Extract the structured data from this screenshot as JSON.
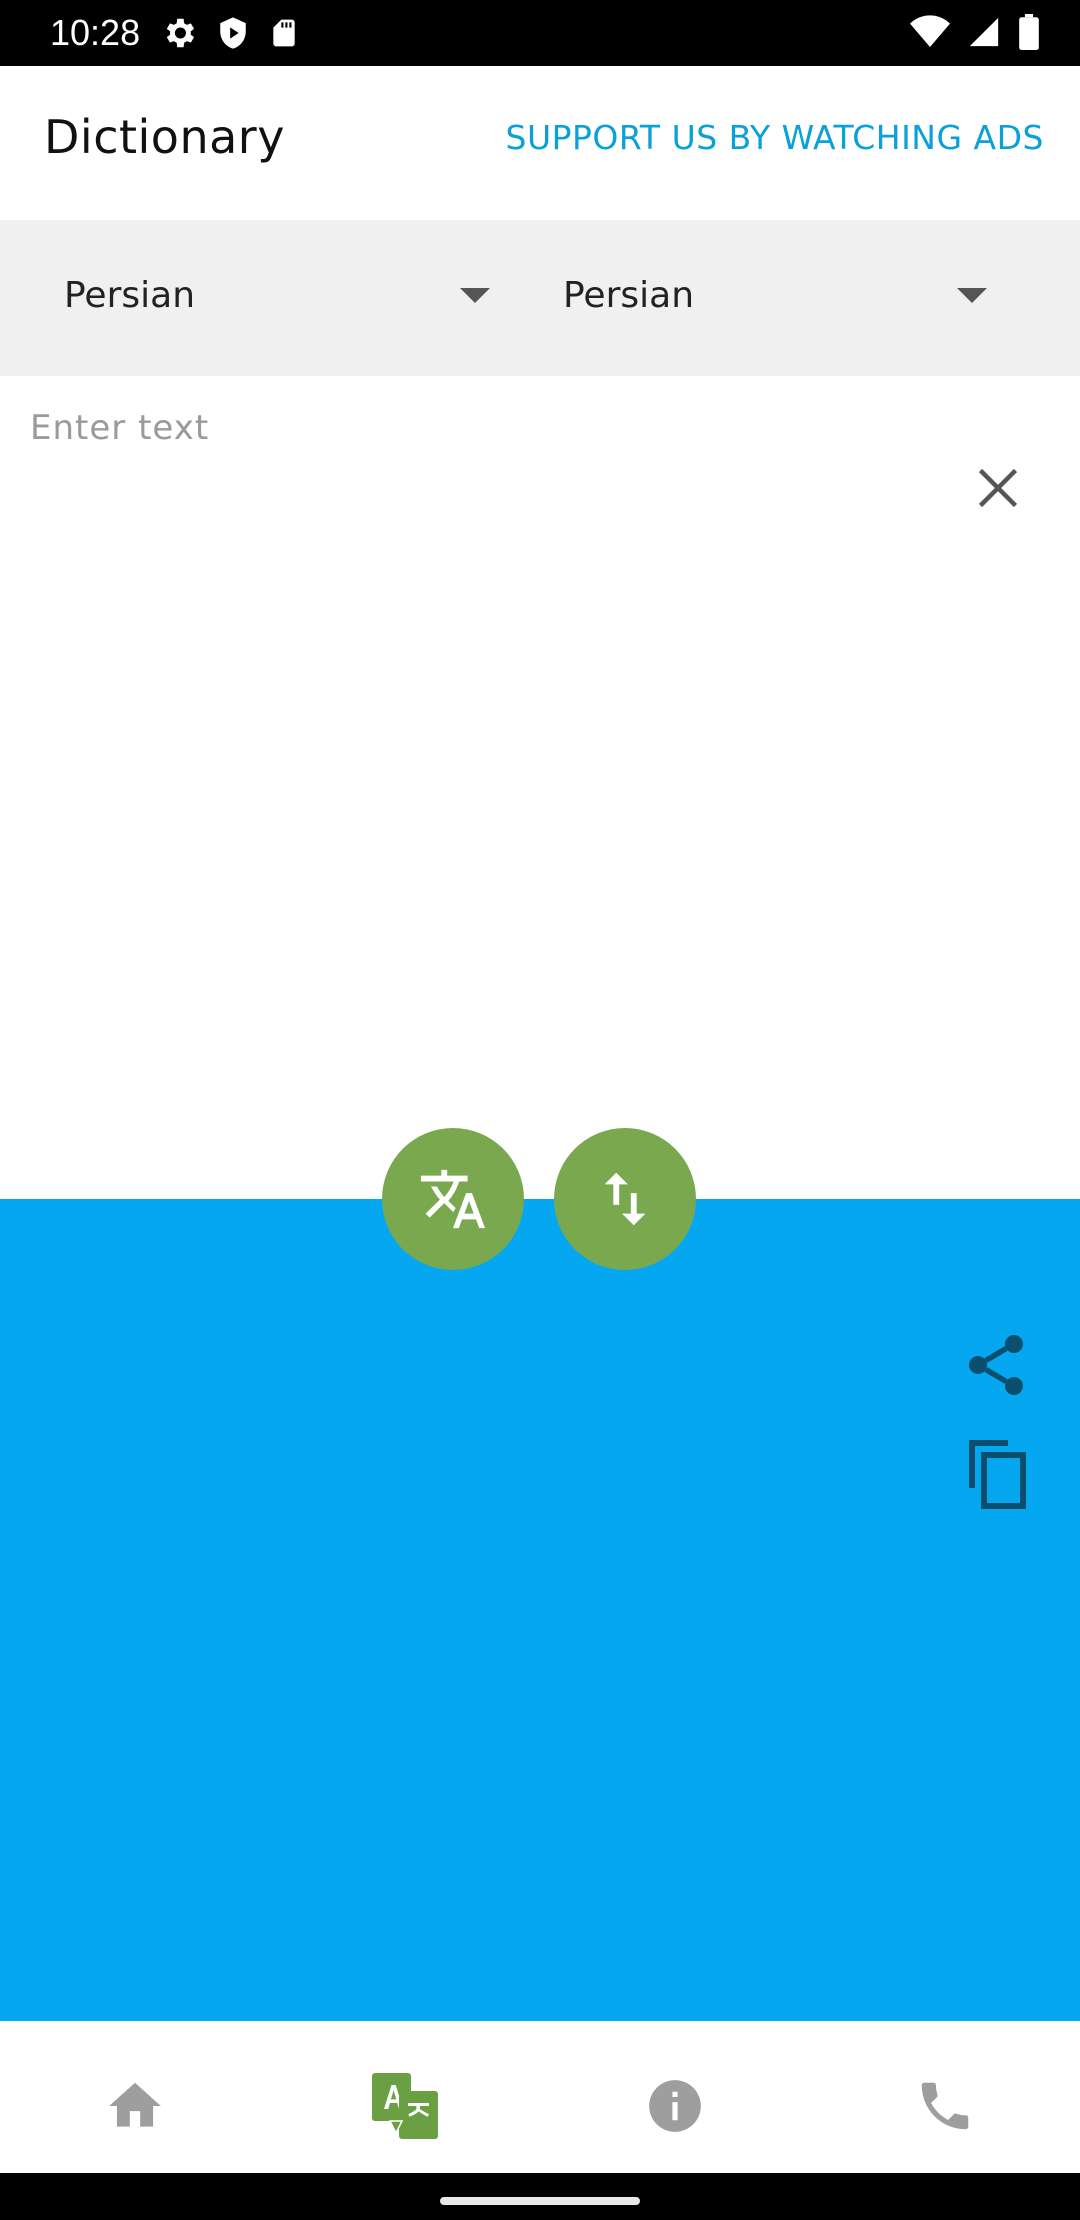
{
  "status": {
    "time": "10:28"
  },
  "header": {
    "title": "Dictionary",
    "support_label": "SUPPORT US BY WATCHING ADS"
  },
  "languages": {
    "from": "Persian",
    "to": "Persian"
  },
  "input": {
    "placeholder": "Enter text",
    "value": ""
  },
  "icons": {
    "status_left": [
      "gear-icon",
      "shield-play-icon",
      "sd-card-icon"
    ],
    "status_right": [
      "wifi-icon",
      "signal-icon",
      "battery-icon"
    ],
    "fab_translate": "translate-icon",
    "fab_swap": "swap-vertical-icon",
    "output_actions": [
      "share-icon",
      "copy-icon"
    ],
    "bottom_nav": [
      "home-icon",
      "translate-icon",
      "info-icon",
      "phone-icon"
    ]
  },
  "colors": {
    "accent_link": "#0aa0d8",
    "output_background": "#05a8f0",
    "fab_green": "#7aa84e",
    "nav_inactive": "#9e9e9e"
  }
}
